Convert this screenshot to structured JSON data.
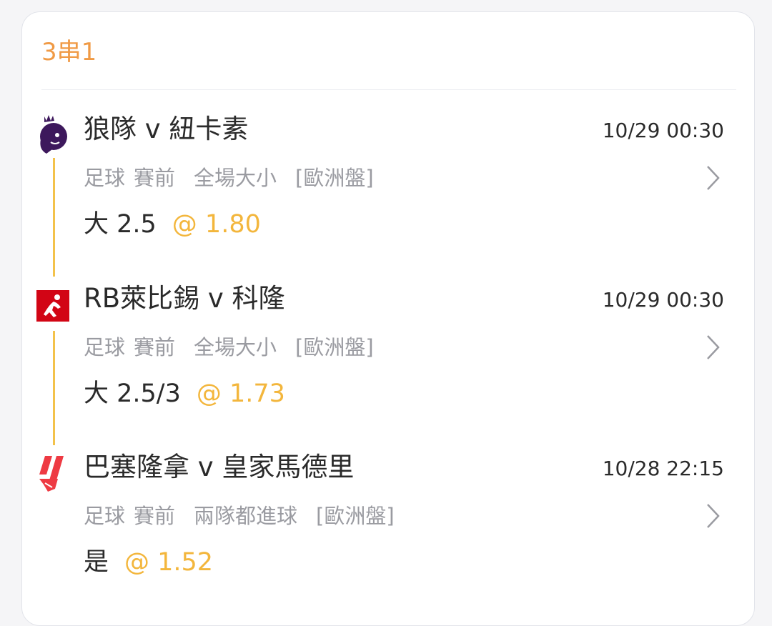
{
  "parlay": {
    "title": "3串1"
  },
  "legs": [
    {
      "league_icon": "premier-league-lion-icon",
      "match": "狼隊 v 紐卡素",
      "time": "10/29 00:30",
      "sport": "足球",
      "stage": "賽前",
      "market": "全場大小",
      "odds_type": "[歐洲盤]",
      "selection": "大 2.5",
      "odds": "@ 1.80"
    },
    {
      "league_icon": "bundesliga-icon",
      "match": "RB萊比錫 v 科隆",
      "time": "10/29 00:30",
      "sport": "足球",
      "stage": "賽前",
      "market": "全場大小",
      "odds_type": "[歐洲盤]",
      "selection": "大 2.5/3",
      "odds": "@ 1.73"
    },
    {
      "league_icon": "laliga-icon",
      "match": "巴塞隆拿 v 皇家馬德里",
      "time": "10/28 22:15",
      "sport": "足球",
      "stage": "賽前",
      "market": "兩隊都進球",
      "odds_type": "[歐洲盤]",
      "selection": "是",
      "odds": "@ 1.52"
    }
  ],
  "colors": {
    "accent_orange": "#f09a45",
    "odds_gold": "#f3b63c",
    "timeline": "#f3c24b",
    "text_primary": "#2a2a2a",
    "text_secondary": "#9a9ba1"
  }
}
